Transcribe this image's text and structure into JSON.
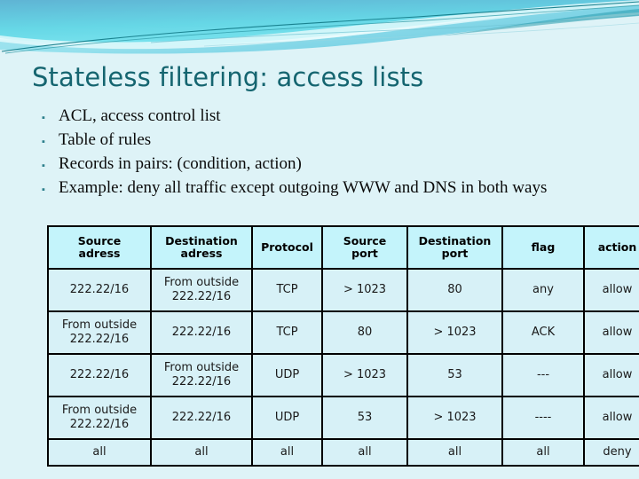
{
  "slide": {
    "title": "Stateless filtering: access lists",
    "background_color": "#def3f7",
    "title_color": "#156570",
    "bullet_marker": "▪"
  },
  "bullets": [
    {
      "text": "ACL, access control list"
    },
    {
      "text": "Table of rules"
    },
    {
      "text": "Records in pairs: (condition, action)"
    },
    {
      "text": "Example: deny all traffic except outgoing WWW and DNS in both ways"
    }
  ],
  "table": {
    "header_bg": "#c4f4fb",
    "cell_bg": "#d7f1f7",
    "action_color": "#3bbdd8",
    "columns": [
      {
        "line1": "Source",
        "line2": "adress"
      },
      {
        "line1": "Destination",
        "line2": "adress"
      },
      {
        "line1": "Protocol",
        "line2": ""
      },
      {
        "line1": "Source",
        "line2": "port"
      },
      {
        "line1": "Destination",
        "line2": "port"
      },
      {
        "line1": "flag",
        "line2": ""
      },
      {
        "line1": "action",
        "line2": ""
      }
    ],
    "rows": [
      {
        "source_address_1": "222.22/16",
        "source_address_2": "",
        "dest_address_1": "From outside",
        "dest_address_2": "222.22/16",
        "protocol": "TCP",
        "source_port": "> 1023",
        "dest_port": "80",
        "flag": "any",
        "action": "allow"
      },
      {
        "source_address_1": "From outside",
        "source_address_2": "222.22/16",
        "dest_address_1": "222.22/16",
        "dest_address_2": "",
        "protocol": "TCP",
        "source_port": "80",
        "dest_port": "> 1023",
        "flag": "ACK",
        "action": "allow"
      },
      {
        "source_address_1": "222.22/16",
        "source_address_2": "",
        "dest_address_1": "From outside",
        "dest_address_2": "222.22/16",
        "protocol": "UDP",
        "source_port": "> 1023",
        "dest_port": "53",
        "flag": "---",
        "action": "allow"
      },
      {
        "source_address_1": "From outside",
        "source_address_2": "222.22/16",
        "dest_address_1": "222.22/16",
        "dest_address_2": "",
        "protocol": "UDP",
        "source_port": "53",
        "dest_port": "> 1023",
        "flag": "----",
        "action": "allow"
      },
      {
        "source_address_1": "all",
        "source_address_2": "",
        "dest_address_1": "all",
        "dest_address_2": "",
        "protocol": "all",
        "source_port": "all",
        "dest_port": "all",
        "flag": "all",
        "action": "deny"
      }
    ]
  }
}
